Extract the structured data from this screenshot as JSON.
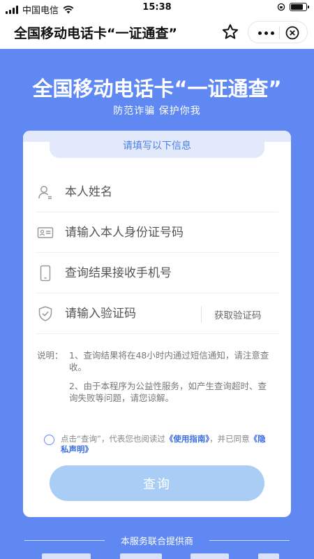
{
  "status_bar": {
    "carrier": "中国电信",
    "time": "15:38"
  },
  "nav": {
    "title": "全国移动电话卡“一证通查”"
  },
  "banner": {
    "title": "全国移动电话卡“一证通查”",
    "subtitle": "防范诈骗 保护你我"
  },
  "form": {
    "header": "请填写以下信息",
    "name_placeholder": "本人姓名",
    "id_placeholder": "请输入本人身份证号码",
    "phone_placeholder": "查询结果接收手机号",
    "code_placeholder": "请输入验证码",
    "get_code_label": "获取验证码"
  },
  "notes": {
    "label": "说明：",
    "item1": "1、查询结果将在48小时内通过短信通知，请注意查收。",
    "item2": "2、由于本程序为公益性服务，如产生查询超时、查询失败等问题，请您谅解。"
  },
  "agreement": {
    "prefix": "点击“查询”，代表您也阅读过",
    "guide_link": "《使用指南》",
    "middle": "，并已同意",
    "privacy_link": "《隐私声明》"
  },
  "submit_label": "查询",
  "footer": {
    "providers_label": "本服务联合提供商"
  },
  "colors": {
    "background": "#5f88f3",
    "accent": "#4f7fe6",
    "button_disabled": "#a9cdf5"
  },
  "icons": {
    "wifi": "wifi-icon",
    "star": "star-icon",
    "more": "more-icon",
    "close": "close-circle-icon",
    "name": "user-icon",
    "id": "id-card-icon",
    "phone": "phone-icon",
    "code": "shield-check-icon"
  }
}
